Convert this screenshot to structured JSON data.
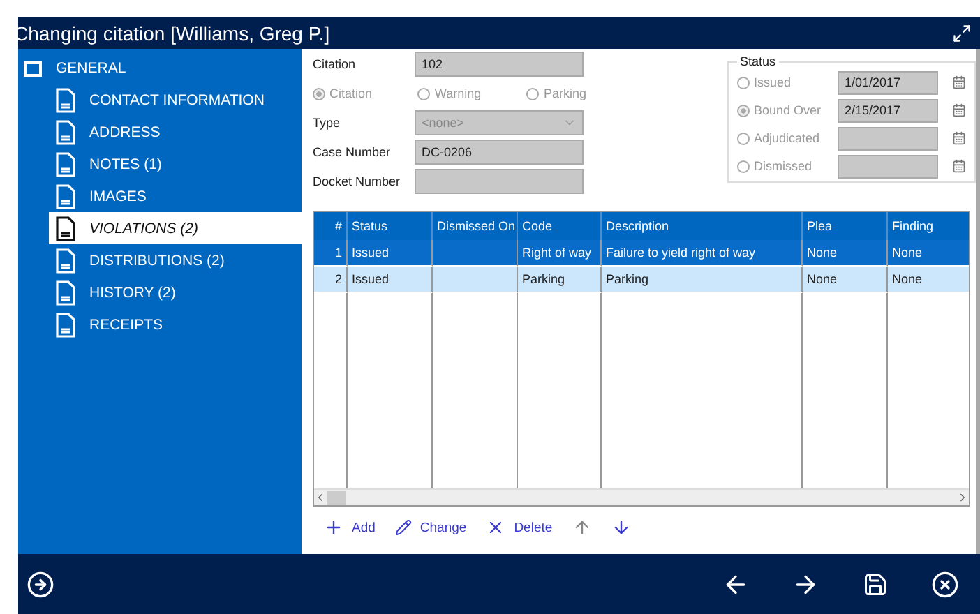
{
  "window": {
    "title": "Changing citation [Williams, Greg P.]"
  },
  "sidebar": {
    "group": "GENERAL",
    "items": [
      {
        "label": "CONTACT INFORMATION",
        "selected": false
      },
      {
        "label": "ADDRESS",
        "selected": false
      },
      {
        "label": "NOTES (1)",
        "selected": false
      },
      {
        "label": "IMAGES",
        "selected": false
      },
      {
        "label": "VIOLATIONS (2)",
        "selected": true
      },
      {
        "label": "DISTRIBUTIONS (2)",
        "selected": false
      },
      {
        "label": "HISTORY (2)",
        "selected": false
      },
      {
        "label": "RECEIPTS",
        "selected": false
      }
    ]
  },
  "form": {
    "citation": {
      "label": "Citation",
      "value": "102"
    },
    "citation_kind": [
      {
        "label": "Citation",
        "selected": true
      },
      {
        "label": "Warning",
        "selected": false
      },
      {
        "label": "Parking",
        "selected": false
      }
    ],
    "type": {
      "label": "Type",
      "placeholder": "<none>"
    },
    "case_number": {
      "label": "Case Number",
      "value": "DC-0206"
    },
    "docket_number": {
      "label": "Docket Number"
    }
  },
  "status": {
    "title": "Status",
    "options": [
      {
        "label": "Issued",
        "selected": false,
        "date": "1/01/2017"
      },
      {
        "label": "Bound Over",
        "selected": true,
        "date": "2/15/2017"
      },
      {
        "label": "Adjudicated",
        "selected": false
      },
      {
        "label": "Dismissed",
        "selected": false
      }
    ]
  },
  "table": {
    "columns": [
      "#",
      "Status",
      "Dismissed On",
      "Code",
      "Description",
      "Plea",
      "Finding"
    ],
    "rows": [
      {
        "cells": [
          "1",
          "Issued",
          "",
          "Right of way",
          "Failure to yield right of way",
          "None",
          "None"
        ],
        "selected": true
      },
      {
        "cells": [
          "2",
          "Issued",
          "",
          "Parking",
          "Parking",
          "None",
          "None"
        ],
        "selected": false
      }
    ]
  },
  "toolbar": [
    {
      "kind": "add",
      "label": "Add"
    },
    {
      "kind": "change",
      "label": "Change"
    },
    {
      "kind": "delete",
      "label": "Delete"
    },
    {
      "kind": "up"
    },
    {
      "kind": "down"
    }
  ],
  "footer": [
    {
      "kind": "previous"
    },
    {
      "kind": "next"
    },
    {
      "kind": "ok"
    },
    {
      "kind": "cancel"
    }
  ]
}
